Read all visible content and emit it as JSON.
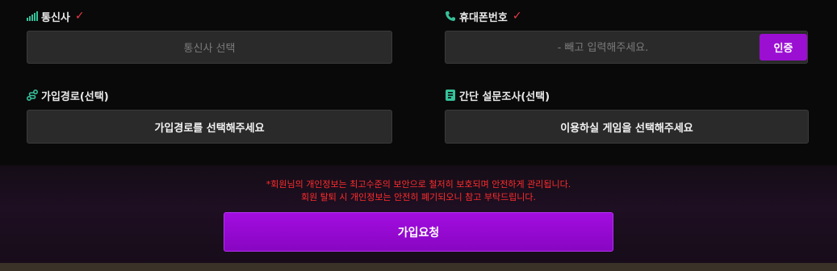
{
  "carrier": {
    "label": "통신사",
    "placeholder": "통신사 선택"
  },
  "phone": {
    "label": "휴대폰번호",
    "placeholder": "- 빼고 입력해주세요.",
    "verify_label": "인증"
  },
  "signup_route": {
    "label": "가입경로(선택)",
    "select_text": "가입경로를 선택해주세요"
  },
  "survey": {
    "label": "간단 설문조사(선택)",
    "select_text": "이용하실 게임을 선택해주세요"
  },
  "notice": {
    "line1": "*회원님의 개인정보는 최고수준의 보안으로 철저히 보호되며 안전하게 관리됩니다.",
    "line2": "회원 탈퇴 시 개인정보는 안전히 폐기되오니 참고 부탁드립니다."
  },
  "submit_label": "가입요청",
  "colors": {
    "accent": "#9b0fd3",
    "required_mark": "#e83a4b",
    "notice": "#ff2c2c"
  },
  "icons": {
    "carrier": "signal-bars-icon",
    "phone": "phone-ring-icon",
    "signup_route": "route-icon",
    "survey": "clipboard-icon",
    "required": "check-icon"
  }
}
